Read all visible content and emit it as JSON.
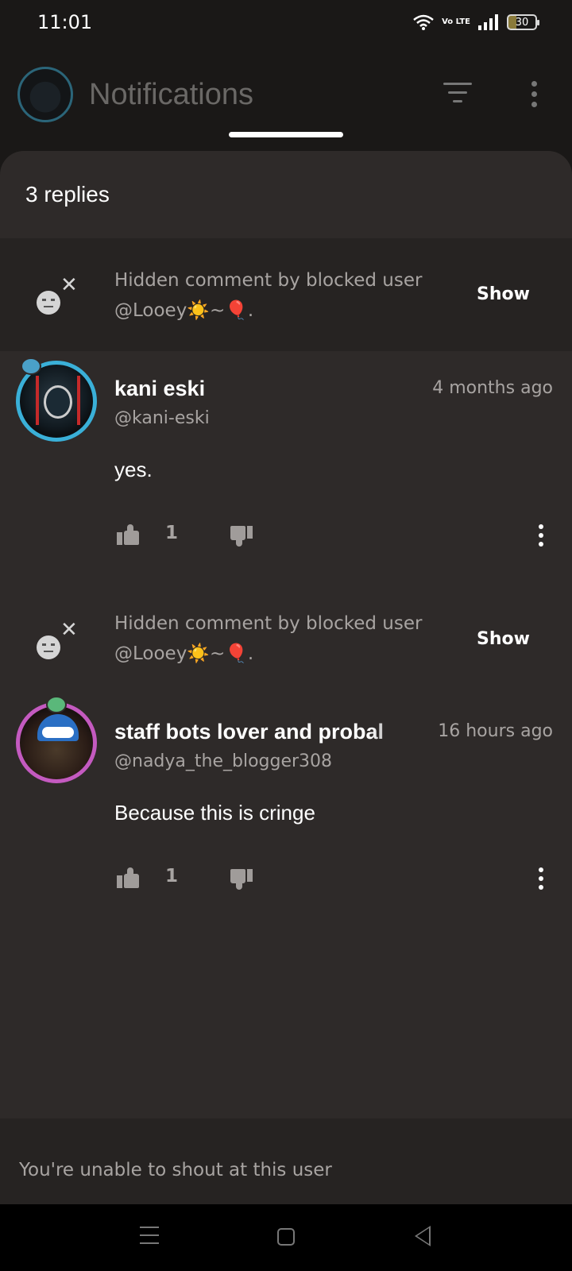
{
  "status_bar": {
    "time": "11:01",
    "battery": "30",
    "network": "Vo LTE"
  },
  "app_bar": {
    "title": "Notifications"
  },
  "sheet": {
    "header": "3 replies",
    "items": [
      {
        "type": "hidden",
        "text": "Hidden comment by blocked user @Looey☀️~🎈.",
        "show_label": "Show"
      },
      {
        "type": "comment",
        "name": "kani eski",
        "handle": "@kani-eski",
        "time": "4 months ago",
        "body": "yes.",
        "likes": "1"
      },
      {
        "type": "hidden",
        "text": "Hidden comment by blocked user @Looey☀️~🎈.",
        "show_label": "Show"
      },
      {
        "type": "comment",
        "name": "staff bots lover and probal",
        "handle": "@nadya_the_blogger308",
        "time": "16 hours ago",
        "body": "Because this is cringe",
        "likes": "1"
      }
    ],
    "footer": "You're unable to shout at this user"
  }
}
